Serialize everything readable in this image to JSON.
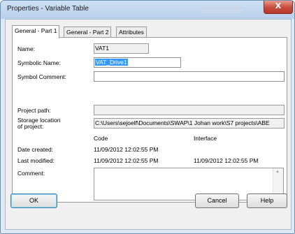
{
  "window": {
    "title": "Properties - Variable Table",
    "close_label": "X"
  },
  "tabs": [
    {
      "label": "General - Part 1",
      "active": true
    },
    {
      "label": "General - Part 2",
      "active": false
    },
    {
      "label": "Attributes",
      "active": false
    }
  ],
  "fields": {
    "name_label": "Name:",
    "name_value": "VAT1",
    "symbolic_name_label": "Symbolic Name:",
    "symbolic_name_value": "VAT_Drive1",
    "symbol_comment_label": "Symbol Comment:",
    "symbol_comment_value": "",
    "project_path_label": "Project path:",
    "project_path_value": "",
    "storage_label_line1": "Storage location",
    "storage_label_line2": "of project:",
    "storage_value": "C:\\Users\\sejoelf\\Documents\\SWAP\\1 Johan work\\S7 projects\\ABE",
    "code_header": "Code",
    "interface_header": "Interface",
    "date_created_label": "Date created:",
    "date_created_code": "11/09/2012 12:02:55 PM",
    "last_modified_label": "Last modified:",
    "last_modified_code": "11/09/2012 12:02:55 PM",
    "last_modified_interface": "11/09/2012 12:02:55 PM",
    "comment_label": "Comment:",
    "comment_value": ""
  },
  "buttons": {
    "ok": "OK",
    "cancel": "Cancel",
    "help": "Help"
  }
}
